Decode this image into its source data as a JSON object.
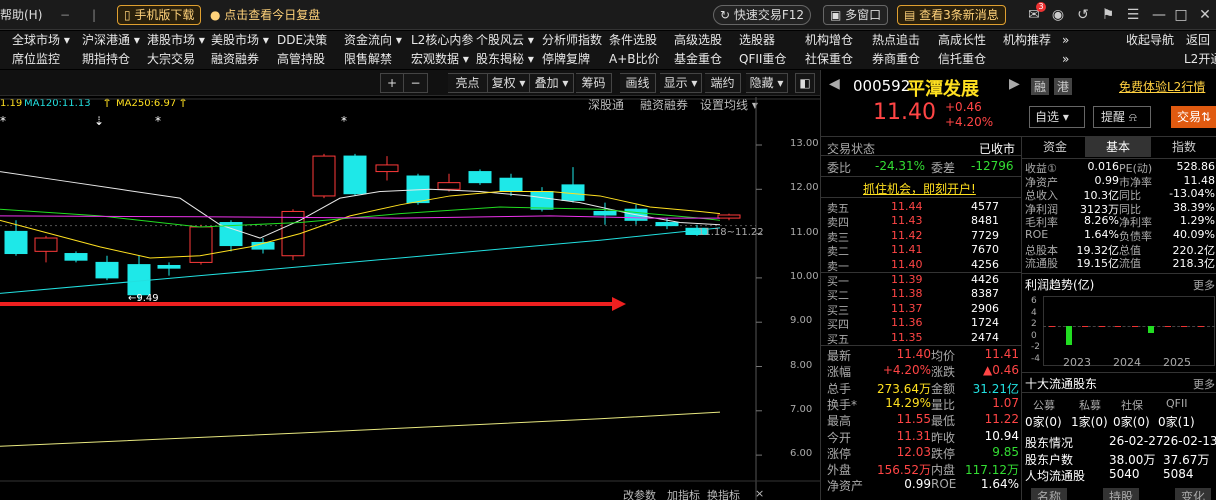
{
  "topbar": {
    "help": "帮助(H)",
    "mobile": "手机版下载",
    "review": "点击查看今日复盘",
    "quicktrade": "快速交易F12",
    "multiwin": "多窗口",
    "news": "查看3条新消息",
    "msg_badge": "3"
  },
  "menu1": [
    "全球市场 ▾",
    "沪深港通 ▾",
    "港股市场 ▾",
    "美股市场 ▾",
    "DDE决策",
    "资金流向 ▾",
    "L2核心内参",
    "个股风云 ▾",
    "分析师指数",
    "条件选股",
    "高级选股",
    "选股器",
    "机构增仓",
    "热点追击",
    "高成长性",
    "机构推荐",
    "»",
    "收起导航",
    "返回"
  ],
  "menu2": [
    "席位监控",
    "期指持仓",
    "大宗交易",
    "融资融券",
    "高管持股",
    "限售解禁",
    "宏观数据 ▾",
    "股东揭秘 ▾",
    "停牌复牌",
    "A+B比价",
    "基金重仓",
    "QFII重仓",
    "社保重仓",
    "券商重仓",
    "信托重仓",
    "»",
    "L2开通"
  ],
  "toolbar": {
    "buttons": [
      "+",
      "−",
      "亮点",
      "复权 ▾",
      "叠加 ▾",
      "筹码",
      "画线",
      "显示 ▾",
      "端约",
      "隐藏 ▾"
    ]
  },
  "chart": {
    "ma_labels": [
      {
        "text": "1.19",
        "color": "#ffe020"
      },
      {
        "text": "MA120:11.13",
        "color": "#22e0e0"
      },
      {
        "text": "MA250:6.97",
        "color": "#ffe020"
      }
    ],
    "subtabs": [
      "深股通",
      "融资融券",
      "设置均线 ▾"
    ],
    "y_ticks": [
      "13.00",
      "12.00",
      "11.00",
      "10.00",
      "9.00",
      "8.00",
      "7.00",
      "6.00"
    ],
    "low_label": "←9.49",
    "last_label": "11.18~11.22",
    "bottom_tabs": [
      "改参数",
      "加指标",
      "换指标"
    ],
    "close_icon": "×"
  },
  "chart_data": {
    "type": "candlestick",
    "ylim": [
      6.0,
      13.0
    ],
    "low": 9.49,
    "ma120": 11.13,
    "ma250": 6.97
  },
  "quote": {
    "code": "000592",
    "name": "平潭发展",
    "price": "11.40",
    "change": "+0.46",
    "pct": "+4.20%",
    "tag1": "融",
    "tag2": "港",
    "l2link": "免费体验L2行情",
    "zixuan": "自选",
    "tixing": "提醒",
    "trade": "交易"
  },
  "status": {
    "label": "交易状态",
    "value": "已收市"
  },
  "webi": {
    "l1": "委比",
    "v1": "-24.31%",
    "l2": "委差",
    "v2": "-12796"
  },
  "promo": "抓住机会，即刻开户!",
  "sell": [
    {
      "n": "卖五",
      "p": "11.44",
      "v": "4577"
    },
    {
      "n": "卖四",
      "p": "11.43",
      "v": "8481"
    },
    {
      "n": "卖三",
      "p": "11.42",
      "v": "7729"
    },
    {
      "n": "卖二",
      "p": "11.41",
      "v": "7670"
    },
    {
      "n": "卖一",
      "p": "11.40",
      "v": "4256"
    }
  ],
  "buy": [
    {
      "n": "买一",
      "p": "11.39",
      "v": "4426"
    },
    {
      "n": "买二",
      "p": "11.38",
      "v": "8387"
    },
    {
      "n": "买三",
      "p": "11.37",
      "v": "2906"
    },
    {
      "n": "买四",
      "p": "11.36",
      "v": "1724"
    },
    {
      "n": "买五",
      "p": "11.35",
      "v": "2474"
    }
  ],
  "stats": [
    {
      "l1": "最新",
      "v1": "11.40",
      "c1": "red",
      "l2": "均价",
      "v2": "11.41",
      "c2": "red"
    },
    {
      "l1": "涨幅",
      "v1": "+4.20%",
      "c1": "red",
      "l2": "涨跌",
      "v2": "▲0.46",
      "c2": "red"
    },
    {
      "l1": "总手",
      "v1": "273.64万",
      "c1": "yellow",
      "l2": "金额",
      "v2": "31.21亿",
      "c2": "cyan"
    },
    {
      "l1": "换手*",
      "v1": "14.29%",
      "c1": "yellow",
      "l2": "量比",
      "v2": "1.07",
      "c2": "red"
    },
    {
      "l1": "最高",
      "v1": "11.55",
      "c1": "red",
      "l2": "最低",
      "v2": "11.22",
      "c2": "red"
    },
    {
      "l1": "今开",
      "v1": "11.31",
      "c1": "red",
      "l2": "昨收",
      "v2": "10.94",
      "c2": "white"
    },
    {
      "l1": "涨停",
      "v1": "12.03",
      "c1": "red",
      "l2": "跌停",
      "v2": "9.85",
      "c2": "green"
    },
    {
      "l1": "外盘",
      "v1": "156.52万",
      "c1": "red",
      "l2": "内盘",
      "v2": "117.12万",
      "c2": "green"
    },
    {
      "l1": "净资产",
      "v1": "0.99",
      "c1": "white",
      "l2": "ROE",
      "v2": "1.64%",
      "c2": "white"
    }
  ],
  "ftabs": [
    "资金",
    "基本",
    "指数"
  ],
  "fin": [
    {
      "l1": "收益①",
      "v1": "0.016",
      "l2": "PE(动)",
      "v2": "528.86"
    },
    {
      "l1": "净资产",
      "v1": "0.99",
      "l2": "市净率",
      "v2": "11.48"
    },
    {
      "l1": "总收入",
      "v1": "10.3亿",
      "l2": "同比",
      "v2": "-13.04%"
    },
    {
      "l1": "净利润",
      "v1": "3123万",
      "l2": "同比",
      "v2": "38.39%"
    },
    {
      "l1": "毛利率",
      "v1": "8.26%",
      "l2": "净利率",
      "v2": "1.29%"
    },
    {
      "l1": "ROE",
      "v1": "1.64%",
      "l2": "负债率",
      "v2": "40.09%"
    },
    {
      "l1": "总股本",
      "v1": "19.32亿",
      "l2": "总值",
      "v2": "220.2亿"
    },
    {
      "l1": "流通股",
      "v1": "19.15亿",
      "l2": "流值",
      "v2": "218.3亿"
    }
  ],
  "profit": {
    "title": "利润趋势(亿)",
    "more": "更多",
    "y": [
      "6",
      "4",
      "2",
      "0",
      "-2",
      "-4"
    ],
    "x": [
      "2023",
      "2024",
      "2025"
    ],
    "bars": [
      0,
      -2.4,
      0,
      0,
      0,
      0,
      -0.9,
      0,
      0,
      0.05
    ]
  },
  "holders": {
    "title": "十大流通股东",
    "more": "更多",
    "cols": [
      "公募",
      "私募",
      "社保",
      "QFII"
    ],
    "vals": [
      "0家(0)",
      "1家(0)",
      "0家(0)",
      "0家(1)"
    ],
    "rows": [
      {
        "l": "股东情况",
        "a": "26-02-27",
        "b": "26-02-13"
      },
      {
        "l": "股东户数",
        "a": "38.00万",
        "b": "37.67万"
      },
      {
        "l": "人均流通股",
        "a": "5040",
        "b": "5084"
      }
    ],
    "last": [
      "名称",
      "持股",
      "变化"
    ]
  }
}
